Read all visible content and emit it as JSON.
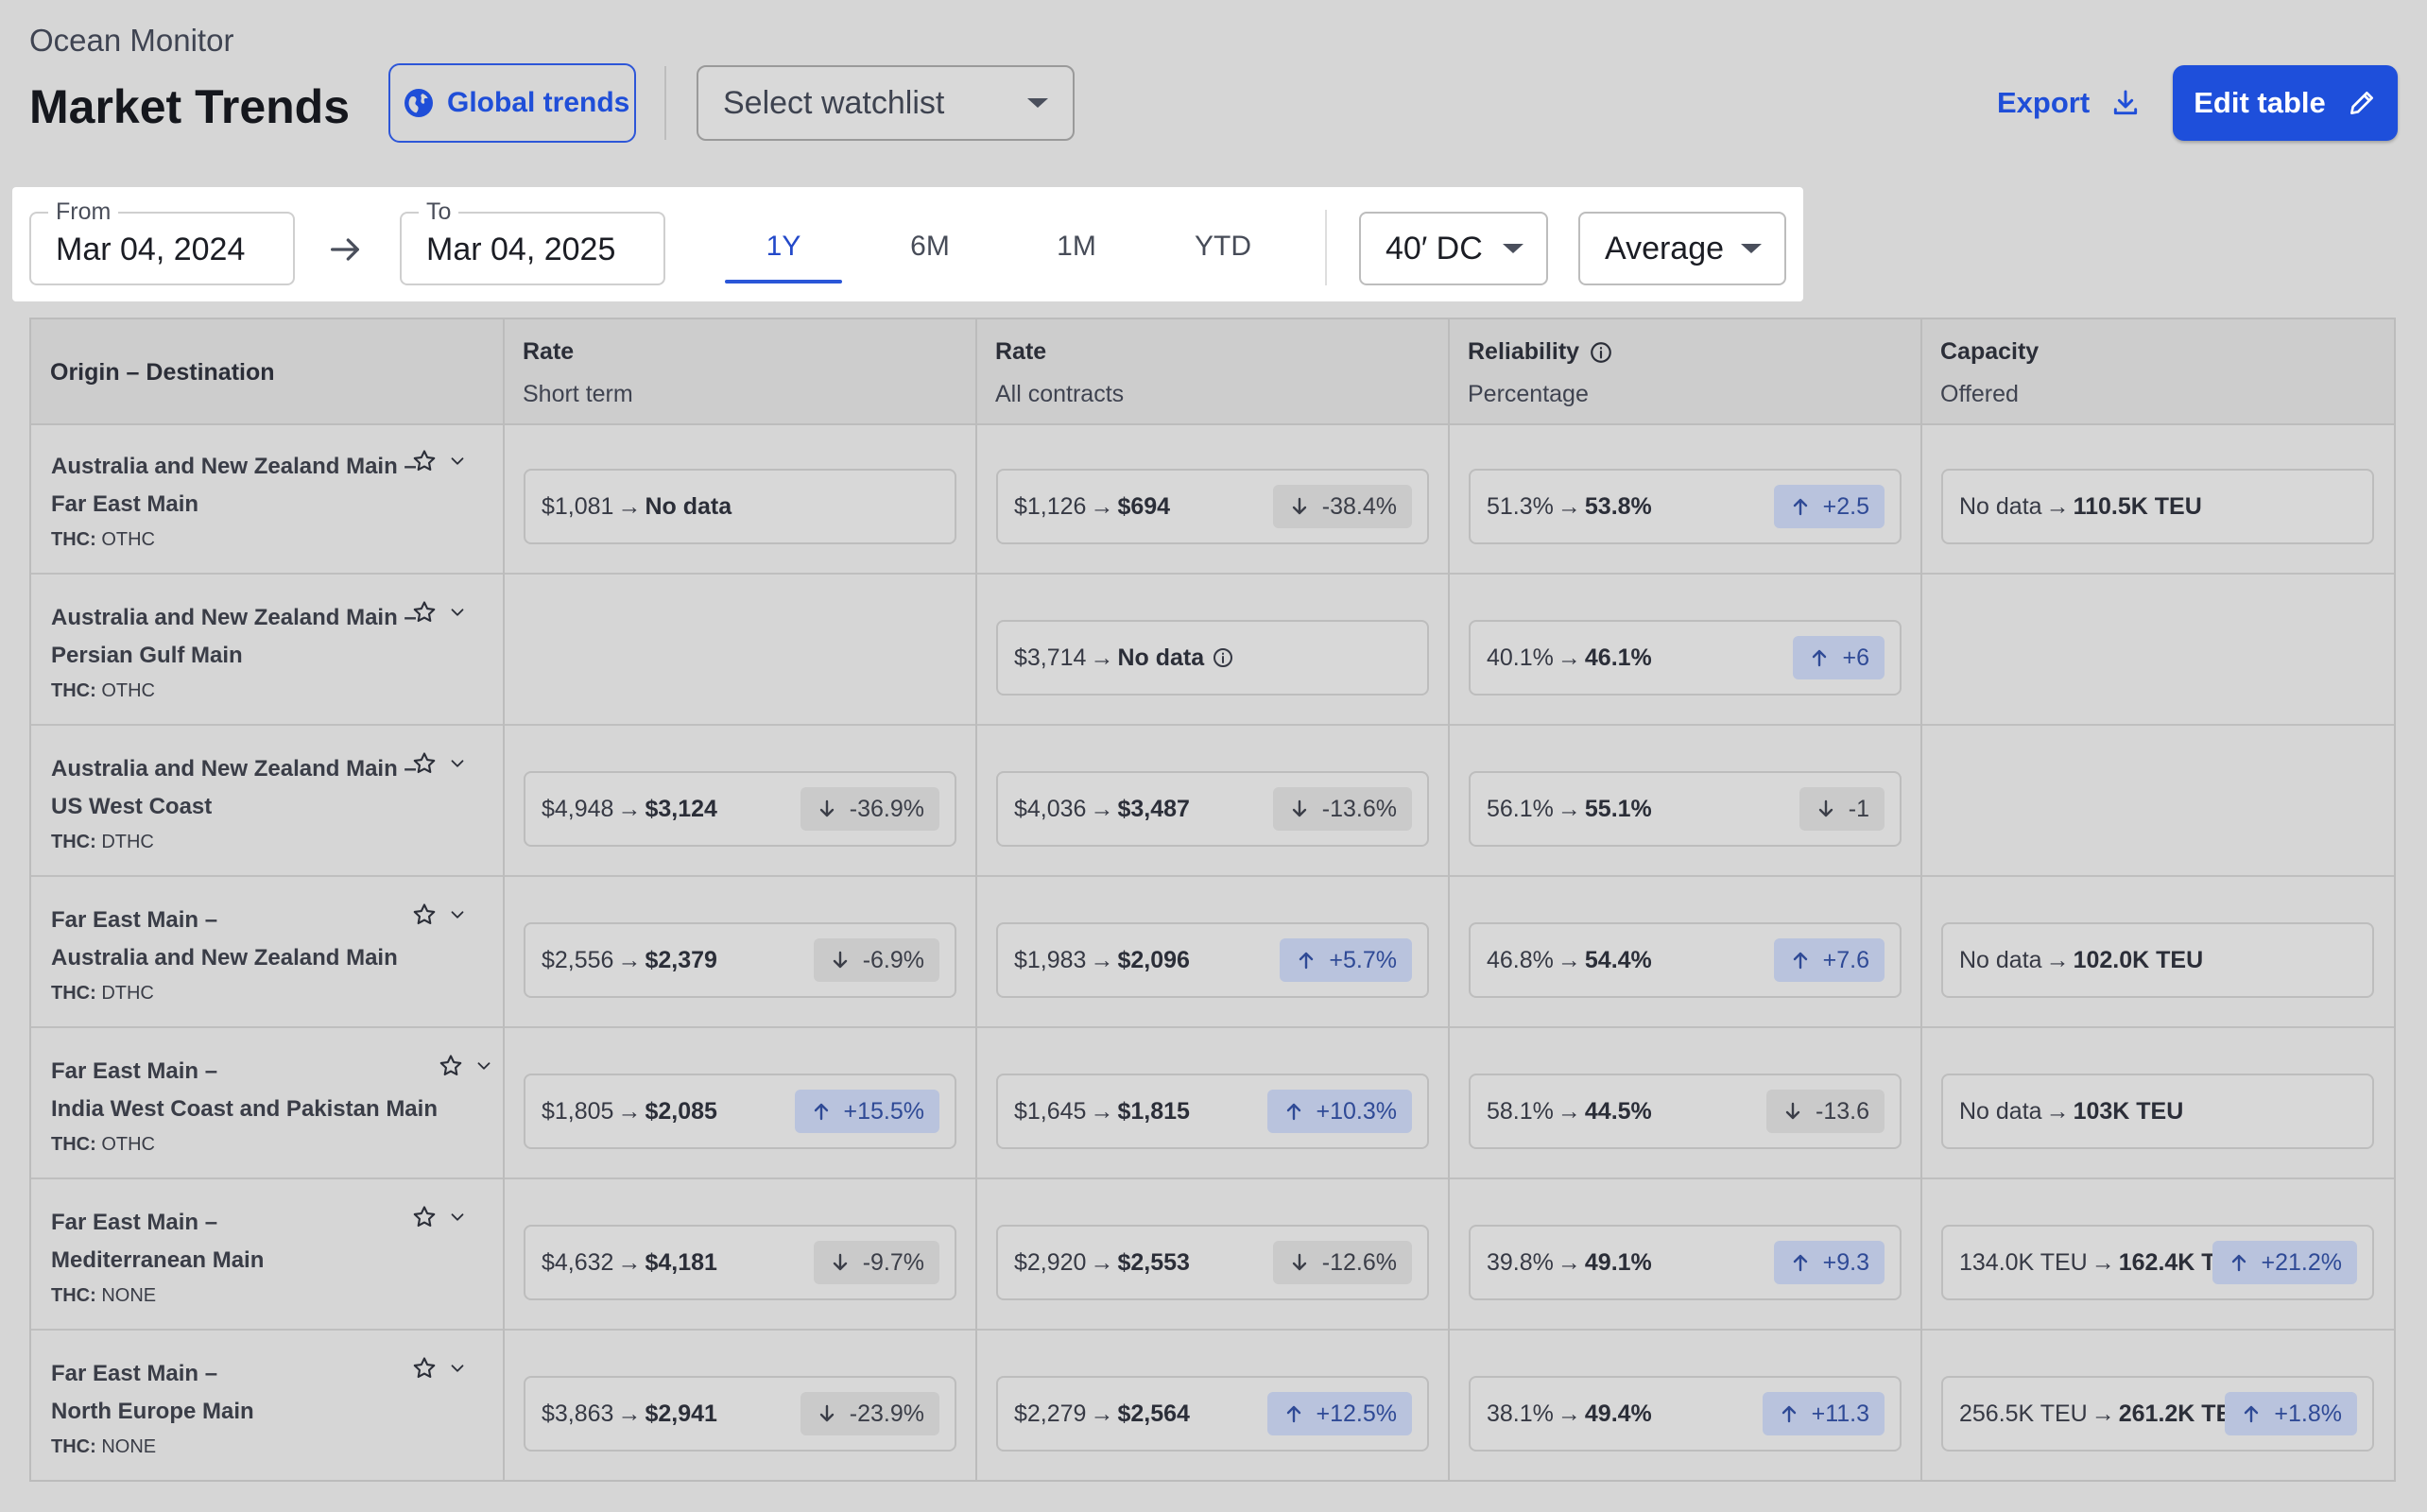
{
  "header": {
    "app_name": "Ocean Monitor",
    "title": "Market Trends",
    "global_trends_label": "Global trends",
    "watchlist_placeholder": "Select watchlist",
    "export_label": "Export",
    "edit_table_label": "Edit table"
  },
  "filters": {
    "from_label": "From",
    "from_value": "Mar 04, 2024",
    "to_label": "To",
    "to_value": "Mar 04, 2025",
    "periods": [
      {
        "label": "1Y",
        "active": true
      },
      {
        "label": "6M",
        "active": false
      },
      {
        "label": "1M",
        "active": false
      },
      {
        "label": "YTD",
        "active": false
      }
    ],
    "container": "40′ DC",
    "aggregation": "Average"
  },
  "columns": [
    {
      "title": "Origin – Destination",
      "subtitle": ""
    },
    {
      "title": "Rate",
      "subtitle": "Short term"
    },
    {
      "title": "Rate",
      "subtitle": "All contracts"
    },
    {
      "title": "Reliability",
      "subtitle": "Percentage"
    },
    {
      "title": "Capacity",
      "subtitle": "Offered"
    }
  ],
  "colors": {
    "accent": "#1e4fdb",
    "up_badge": "#b9c3dd",
    "down_badge": "#cacaca"
  },
  "rows": [
    {
      "line1": "Australia and New Zealand Main –",
      "line2": "Far East Main",
      "thc_label": "THC:",
      "thc": "OTHC",
      "short_term": {
        "from": "$1,081",
        "to": "No data",
        "change": "",
        "dir": ""
      },
      "all_contracts": {
        "from": "$1,126",
        "to": "$694",
        "change": "-38.4%",
        "dir": "down"
      },
      "reliability": {
        "from": "51.3%",
        "to": "53.8%",
        "change": "+2.5",
        "dir": "up"
      },
      "capacity": {
        "from": "No data",
        "to": "110.5K TEU",
        "change": "",
        "dir": ""
      }
    },
    {
      "line1": "Australia and New Zealand Main –",
      "line2": "Persian Gulf Main",
      "thc_label": "THC:",
      "thc": "OTHC",
      "short_term": null,
      "all_contracts": {
        "from": "$3,714",
        "to": "No data",
        "change": "",
        "dir": "",
        "info": true
      },
      "reliability": {
        "from": "40.1%",
        "to": "46.1%",
        "change": "+6",
        "dir": "up"
      },
      "capacity": null
    },
    {
      "line1": "Australia and New Zealand Main –",
      "line2": "US West Coast",
      "thc_label": "THC:",
      "thc": "DTHC",
      "short_term": {
        "from": "$4,948",
        "to": "$3,124",
        "change": "-36.9%",
        "dir": "down"
      },
      "all_contracts": {
        "from": "$4,036",
        "to": "$3,487",
        "change": "-13.6%",
        "dir": "down"
      },
      "reliability": {
        "from": "56.1%",
        "to": "55.1%",
        "change": "-1",
        "dir": "down"
      },
      "capacity": null
    },
    {
      "line1": "Far East Main –",
      "line2": "Australia and New Zealand Main",
      "thc_label": "THC:",
      "thc": "DTHC",
      "short_term": {
        "from": "$2,556",
        "to": "$2,379",
        "change": "-6.9%",
        "dir": "down"
      },
      "all_contracts": {
        "from": "$1,983",
        "to": "$2,096",
        "change": "+5.7%",
        "dir": "up"
      },
      "reliability": {
        "from": "46.8%",
        "to": "54.4%",
        "change": "+7.6",
        "dir": "up"
      },
      "capacity": {
        "from": "No data",
        "to": "102.0K TEU",
        "change": "",
        "dir": ""
      }
    },
    {
      "line1": "Far East Main –",
      "line2": "India West Coast and Pakistan Main",
      "thc_label": "THC:",
      "thc": "OTHC",
      "short_term": {
        "from": "$1,805",
        "to": "$2,085",
        "change": "+15.5%",
        "dir": "up"
      },
      "all_contracts": {
        "from": "$1,645",
        "to": "$1,815",
        "change": "+10.3%",
        "dir": "up"
      },
      "reliability": {
        "from": "58.1%",
        "to": "44.5%",
        "change": "-13.6",
        "dir": "down"
      },
      "capacity": {
        "from": "No data",
        "to": "103K TEU",
        "change": "",
        "dir": ""
      }
    },
    {
      "line1": "Far East Main –",
      "line2": "Mediterranean Main",
      "thc_label": "THC:",
      "thc": "NONE",
      "short_term": {
        "from": "$4,632",
        "to": "$4,181",
        "change": "-9.7%",
        "dir": "down"
      },
      "all_contracts": {
        "from": "$2,920",
        "to": "$2,553",
        "change": "-12.6%",
        "dir": "down"
      },
      "reliability": {
        "from": "39.8%",
        "to": "49.1%",
        "change": "+9.3",
        "dir": "up"
      },
      "capacity": {
        "from": "134.0K TEU",
        "to": "162.4K TEU",
        "change": "+21.2%",
        "dir": "up"
      }
    },
    {
      "line1": "Far East Main –",
      "line2": "North Europe Main",
      "thc_label": "THC:",
      "thc": "NONE",
      "short_term": {
        "from": "$3,863",
        "to": "$2,941",
        "change": "-23.9%",
        "dir": "down"
      },
      "all_contracts": {
        "from": "$2,279",
        "to": "$2,564",
        "change": "+12.5%",
        "dir": "up"
      },
      "reliability": {
        "from": "38.1%",
        "to": "49.4%",
        "change": "+11.3",
        "dir": "up"
      },
      "capacity": {
        "from": "256.5K TEU",
        "to": "261.2K TEU",
        "change": "+1.8%",
        "dir": "up"
      }
    }
  ]
}
